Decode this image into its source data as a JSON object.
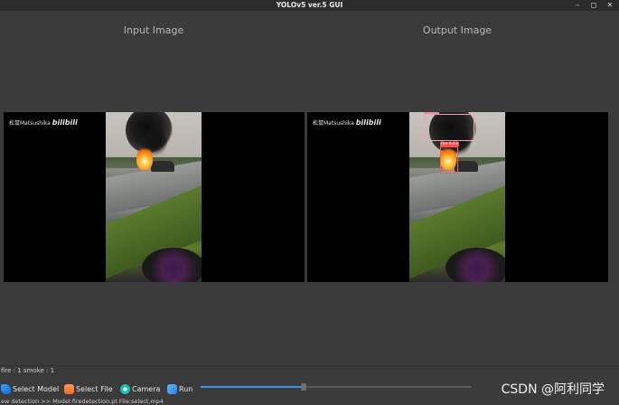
{
  "window": {
    "title": "YOLOv5 ver.5 GUI",
    "controls": [
      "–",
      "◻",
      "✕"
    ]
  },
  "labels": {
    "input": "Input Image",
    "output": "Output Image"
  },
  "video": {
    "watermark": "松鼠Matsushika",
    "logo": "bilibili"
  },
  "detections": [
    {
      "label": "fire 0.63",
      "kind": "fire"
    },
    {
      "label": "smoke",
      "kind": "smoke"
    }
  ],
  "status": {
    "text": "fire : 1 smoke : 1"
  },
  "toolbar": {
    "select_model": "Select Model",
    "select_file": "Select File",
    "camera": "Camera",
    "run": "Run"
  },
  "progress": {
    "value": 0.38
  },
  "footer": {
    "text": "ew detection >> Model:firedetection.pt    File:select.mp4"
  },
  "csdn": {
    "text": "CSDN @阿利同学"
  },
  "colors": {
    "accent": "#3b95e6",
    "box": "#ff5a5a"
  }
}
